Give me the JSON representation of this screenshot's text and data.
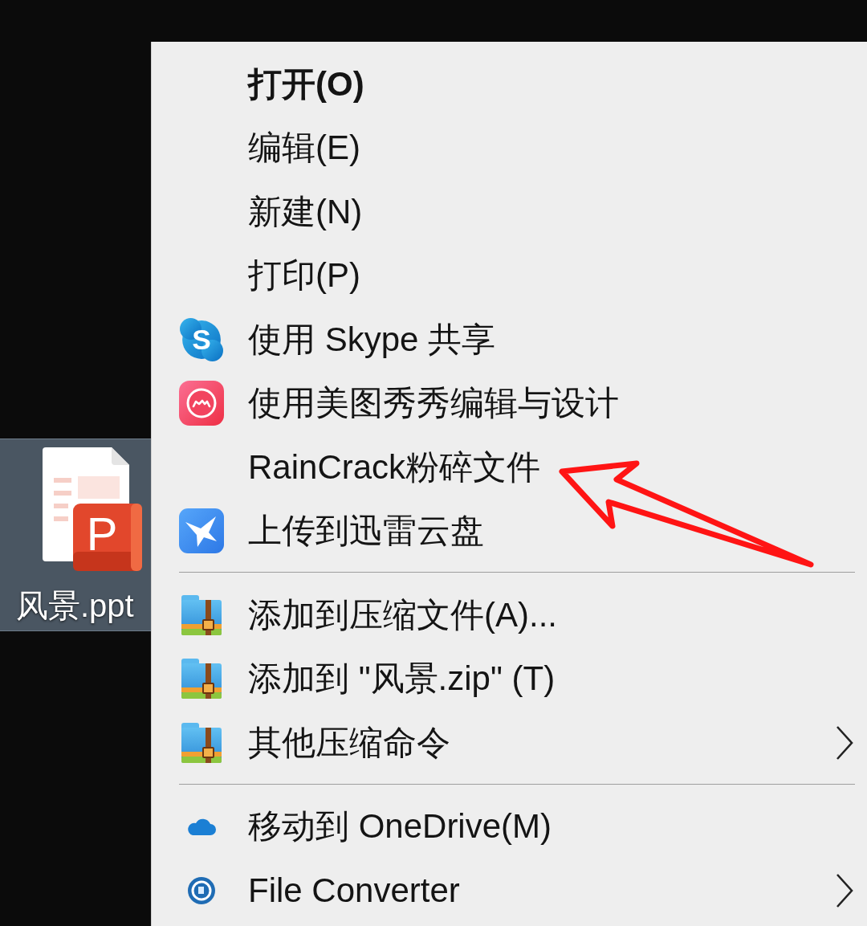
{
  "desktop": {
    "file": {
      "label": "风景.ppt",
      "badge": "P",
      "selected": true
    }
  },
  "context_menu": {
    "groups": [
      {
        "items": [
          {
            "label": "打开(O)",
            "kind": "plain",
            "default": true,
            "submenu": false,
            "annotated": false
          },
          {
            "label": "编辑(E)",
            "kind": "plain",
            "default": false,
            "submenu": false,
            "annotated": false
          },
          {
            "label": "新建(N)",
            "kind": "plain",
            "default": false,
            "submenu": false,
            "annotated": false
          },
          {
            "label": "打印(P)",
            "kind": "plain",
            "default": false,
            "submenu": false,
            "annotated": false
          },
          {
            "label": "使用 Skype 共享",
            "kind": "letter_logo",
            "icon_text": "S",
            "default": false,
            "submenu": false,
            "annotated": false
          },
          {
            "label": "使用美图秀秀编辑与设计",
            "kind": "ring_logo",
            "default": false,
            "submenu": false,
            "annotated": false
          },
          {
            "label": "RainCrack粉碎文件",
            "kind": "plain",
            "default": false,
            "submenu": false,
            "annotated": true
          },
          {
            "label": "上传到迅雷云盘",
            "kind": "bird_logo",
            "default": false,
            "submenu": false,
            "annotated": false
          }
        ]
      },
      {
        "items": [
          {
            "label": "添加到压缩文件(A)...",
            "kind": "zip_folder",
            "default": false,
            "submenu": false,
            "annotated": false
          },
          {
            "label": "添加到 \"风景.zip\" (T)",
            "kind": "zip_folder",
            "default": false,
            "submenu": false,
            "annotated": false
          },
          {
            "label": "其他压缩命令",
            "kind": "zip_folder",
            "default": false,
            "submenu": true,
            "annotated": false
          }
        ]
      },
      {
        "items": [
          {
            "label": "移动到 OneDrive(M)",
            "kind": "cloud",
            "default": false,
            "submenu": false,
            "annotated": false
          },
          {
            "label": "File Converter",
            "kind": "disc_logo",
            "default": false,
            "submenu": true,
            "annotated": false
          }
        ]
      }
    ]
  }
}
